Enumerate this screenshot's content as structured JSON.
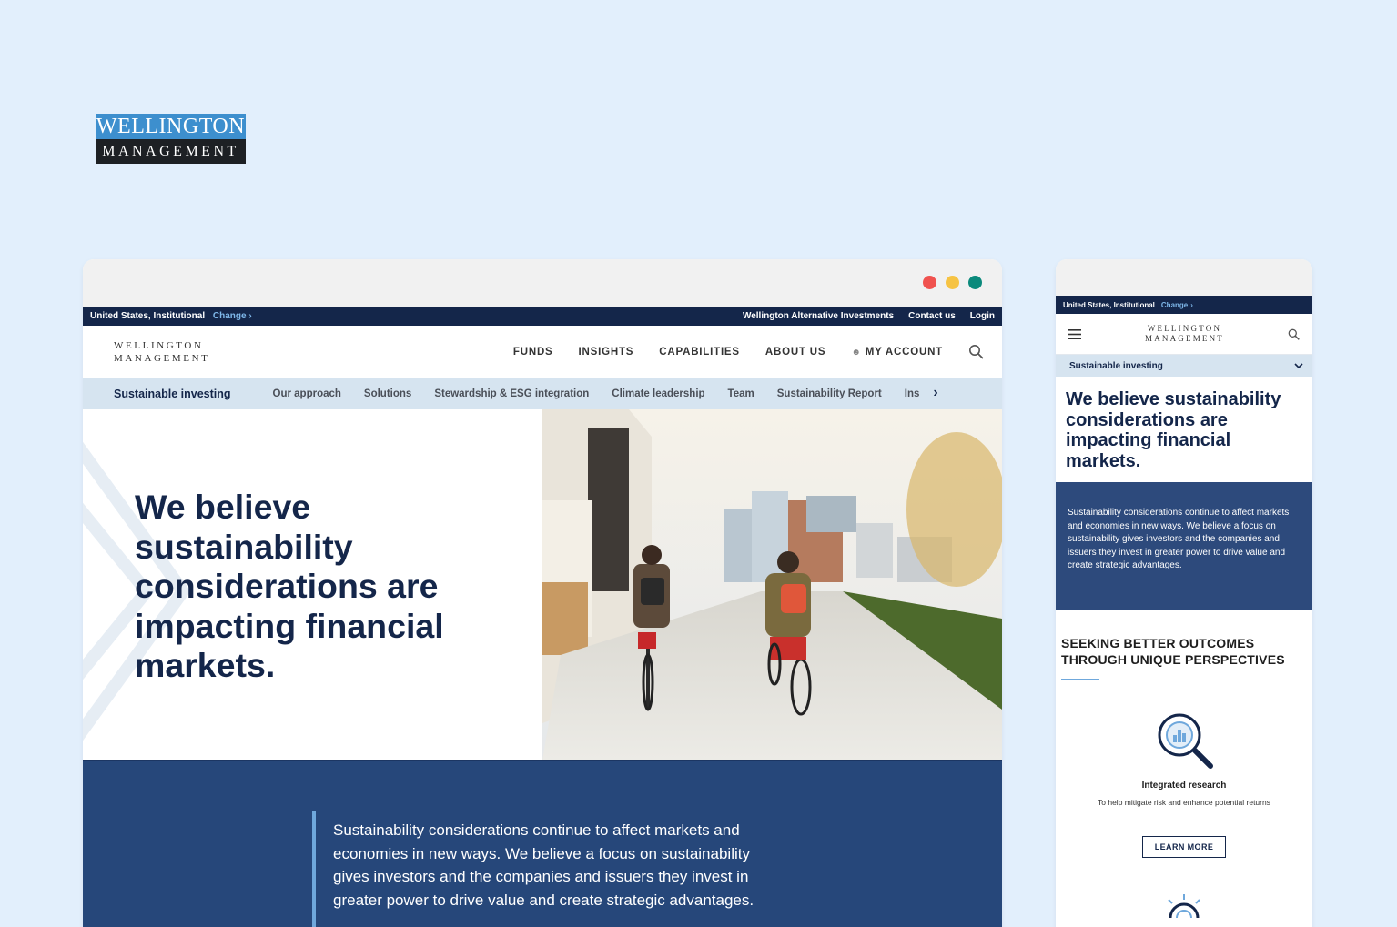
{
  "brand": {
    "line1": "WELLINGTON",
    "line2": "MANAGEMENT"
  },
  "colors": {
    "page_bg": "#e2effc",
    "navy": "#14264a",
    "quote_blue": "#26477a",
    "accent": "#6fa8dc",
    "dot_red": "#f0524f",
    "dot_yellow": "#f6c343",
    "dot_teal": "#0b8a7c"
  },
  "desktop": {
    "util": {
      "region": "United States, Institutional",
      "change": "Change",
      "links": [
        "Wellington Alternative Investments",
        "Contact us",
        "Login"
      ]
    },
    "nav": {
      "logo_line1": "WELLINGTON",
      "logo_line2": "MANAGEMENT",
      "links": [
        "FUNDS",
        "INSIGHTS",
        "CAPABILITIES",
        "ABOUT US"
      ],
      "account": "MY ACCOUNT"
    },
    "subnav": {
      "current": "Sustainable investing",
      "items": [
        "Our approach",
        "Solutions",
        "Stewardship & ESG integration",
        "Climate leadership",
        "Team",
        "Sustainability Report",
        "Ins"
      ]
    },
    "hero": {
      "headline": "We believe sustainability considerations are impacting financial markets."
    },
    "quote": "Sustainability considerations continue to affect markets and economies in new ways. We believe a focus on sustainability gives investors and the companies and issuers they invest in greater power to drive value and create strategic advantages."
  },
  "mobile": {
    "util": {
      "region": "United States, Institutional",
      "change": "Change"
    },
    "logo_line1": "WELLINGTON",
    "logo_line2": "MANAGEMENT",
    "subnav": "Sustainable investing",
    "headline": "We believe sustainability considerations are impacting financial markets.",
    "quote": "Sustainability considerations continue to affect markets and economies in new ways. We believe a focus on sustainability gives investors and the companies and issuers they invest in greater power to drive value and create strategic advantages.",
    "section_title": "SEEKING BETTER OUTCOMES THROUGH UNIQUE PERSPECTIVES",
    "feature": {
      "title": "Integrated research",
      "desc": "To help mitigate risk and enhance potential returns",
      "button": "LEARN MORE"
    }
  }
}
